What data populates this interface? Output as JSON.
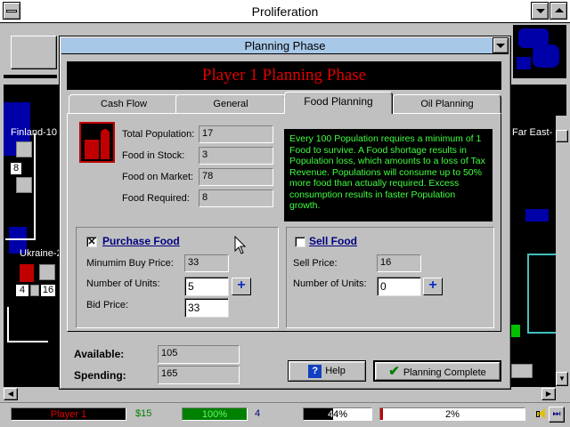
{
  "app": {
    "title": "Proliferation"
  },
  "map": {
    "regions": [
      {
        "name": "Finland-10",
        "count": "8"
      },
      {
        "name": "Ukraine-2",
        "count_a": "4",
        "count_b": "16"
      },
      {
        "name": "Far East-"
      }
    ]
  },
  "dialog": {
    "title": "Planning Phase",
    "banner": "Player 1 Planning Phase",
    "tabs": [
      "Cash Flow",
      "General",
      "Food Planning",
      "Oil Planning"
    ],
    "active_tab": "Food Planning",
    "stats": {
      "total_population_label": "Total Population:",
      "total_population": "17",
      "food_in_stock_label": "Food in Stock:",
      "food_in_stock": "3",
      "food_on_market_label": "Food on Market:",
      "food_on_market": "78",
      "food_required_label": "Food Required:",
      "food_required": "8"
    },
    "info_text": "Every 100 Population requires a minimum of 1 Food to survive.  A Food shortage results in Population loss,   which amounts to a loss of Tax Revenue.  Populations will consume up to 50% more food   than actually required.  Excess consumption results in faster Population growth.",
    "purchase": {
      "checkbox_mark": "✕",
      "label": "Purchase Food",
      "min_price_label": "Minumim Buy Price:",
      "min_price": "33",
      "units_label": "Number of Units:",
      "units": "5",
      "bid_label": "Bid Price:",
      "bid": "33"
    },
    "sell": {
      "label": "Sell Food",
      "price_label": "Sell Price:",
      "price": "16",
      "units_label": "Number of Units:",
      "units": "0"
    },
    "available_label": "Available:",
    "available": "105",
    "spending_label": "Spending:",
    "spending": "165",
    "help_label": "Help",
    "complete_label": "Planning Complete"
  },
  "statusbar": {
    "player": "Player 1",
    "money": "$15",
    "food_pct": "100%",
    "food_fill": 1.0,
    "count": "4",
    "mid_pct": "44%",
    "mid_fill": 0.44,
    "right_pct": "2%",
    "right_fill": 0.02
  },
  "colors": {
    "banner_text": "#e00000",
    "info_text": "#40ff40",
    "title_bar": "#a8c8e8"
  }
}
